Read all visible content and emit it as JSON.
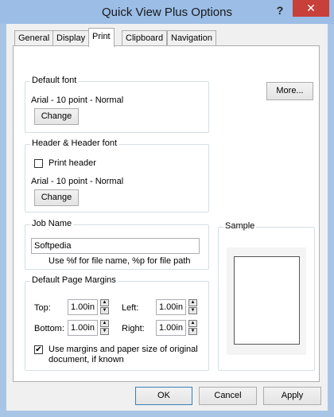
{
  "window": {
    "title": "Quick View Plus Options"
  },
  "title_buttons": {
    "help": "?",
    "close": "✕"
  },
  "tabs": [
    {
      "label": "General"
    },
    {
      "label": "Display"
    },
    {
      "label": "Print"
    },
    {
      "label": "Clipboard"
    },
    {
      "label": "Navigation"
    }
  ],
  "print": {
    "more_button": "More...",
    "default_font": {
      "group_label": "Default font",
      "font_desc": "Arial - 10 point - Normal",
      "change_button": "Change"
    },
    "header_font": {
      "group_label": "Header & Header font",
      "print_header_label": "Print header",
      "print_header_checked": false,
      "font_desc": "Arial - 10 point - Normal",
      "change_button": "Change"
    },
    "job_name": {
      "group_label": "Job Name",
      "value": "Softpedia",
      "hint": "Use %f for file name, %p for file path"
    },
    "margins": {
      "group_label": "Default Page Margins",
      "top_label": "Top:",
      "top_value": "1.00in",
      "left_label": "Left:",
      "left_value": "1.00in",
      "bottom_label": "Bottom:",
      "bottom_value": "1.00in",
      "right_label": "Right:",
      "right_value": "1.00in",
      "use_original_line1": "Use margins and paper size of original",
      "use_original_line2": "document, if known",
      "use_original_checked": true
    },
    "sample": {
      "group_label": "Sample"
    }
  },
  "footer": {
    "ok": "OK",
    "cancel": "Cancel",
    "apply": "Apply"
  },
  "icons": {
    "checkmark": "✔",
    "spin_up": "▲",
    "spin_down": "▼"
  }
}
